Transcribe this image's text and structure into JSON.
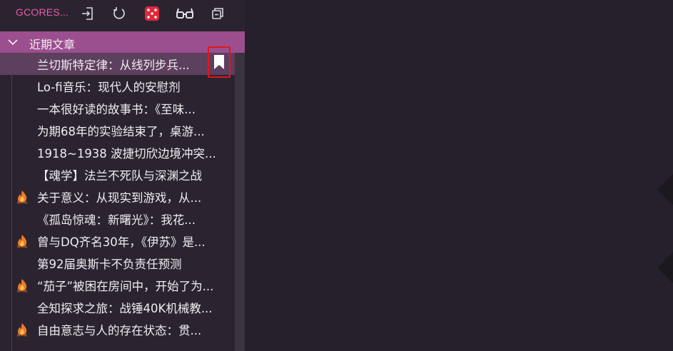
{
  "app": {
    "title": "GCORES..."
  },
  "toolbar": {
    "icons": [
      "logout-icon",
      "refresh-icon",
      "dice-icon",
      "glasses-icon",
      "collapse-all-icon"
    ]
  },
  "section": {
    "title": "近期文章",
    "expanded": true
  },
  "articles": [
    {
      "title": "兰切斯特定律：从线列步兵...",
      "hot": false,
      "selected": true,
      "bookmark": true
    },
    {
      "title": "Lo-fi音乐：现代人的安慰剂",
      "hot": false
    },
    {
      "title": "一本很好读的故事书：《至味...",
      "hot": false
    },
    {
      "title": "为期68年的实验结束了，桌游...",
      "hot": false
    },
    {
      "title": "1918~1938 波捷切欣边境冲突...",
      "hot": false
    },
    {
      "title": "【魂学】法兰不死队与深渊之战",
      "hot": false
    },
    {
      "title": "关于意义：从现实到游戏，从...",
      "hot": true
    },
    {
      "title": "《孤岛惊魂：新曙光》：我花...",
      "hot": false
    },
    {
      "title": "曾与DQ齐名30年，《伊苏》是...",
      "hot": true
    },
    {
      "title": "第92届奥斯卡不负责任预测",
      "hot": false
    },
    {
      "title": "“茄子”被困在房间中，开始了为...",
      "hot": true
    },
    {
      "title": "全知探求之旅：战锤40K机械教...",
      "hot": false
    },
    {
      "title": "自由意志与人的存在状态：贯...",
      "hot": true
    }
  ],
  "colors": {
    "accent": "#e85aad",
    "header_bg": "#9c4f8e",
    "selected_bg": "#5d3f5e",
    "highlight_box": "#e3161b"
  }
}
